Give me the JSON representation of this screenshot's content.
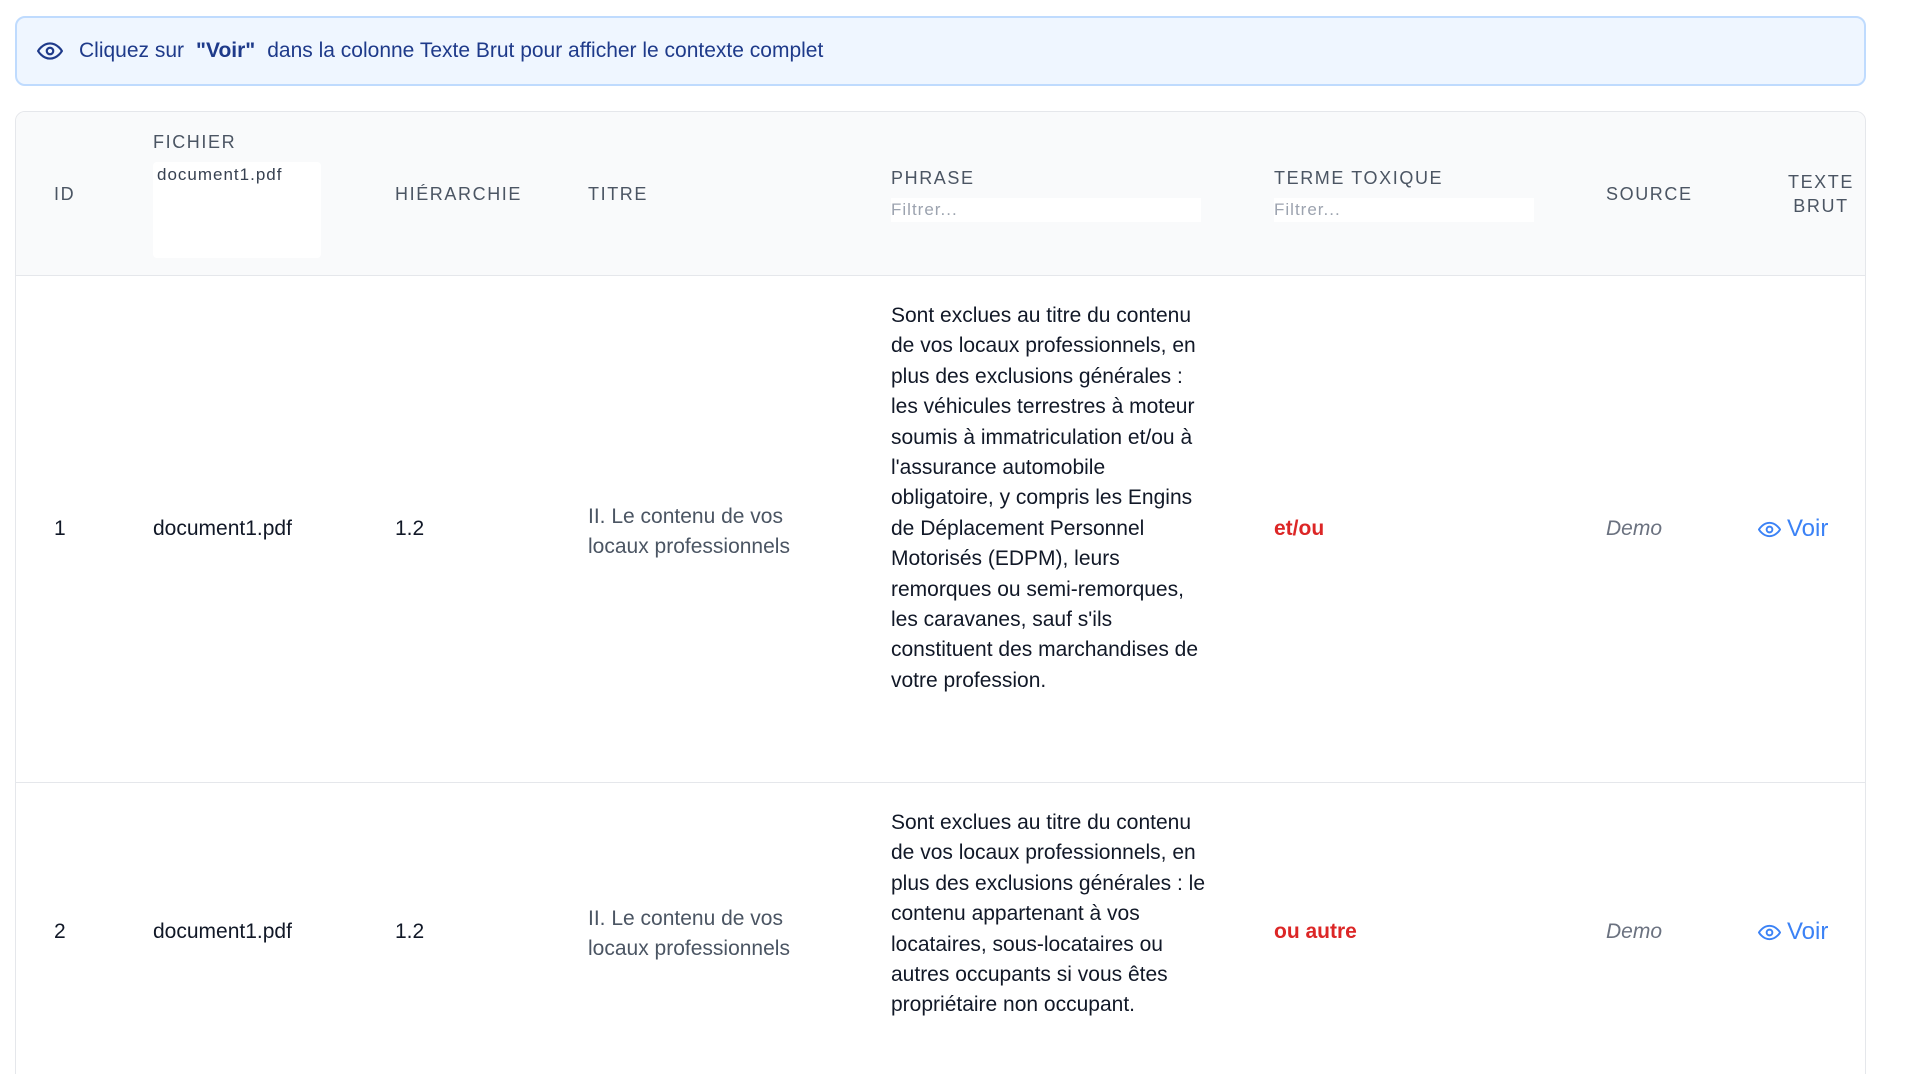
{
  "banner": {
    "prefix": "Cliquez sur",
    "strong": "\"Voir\"",
    "suffix": "dans la colonne Texte Brut pour afficher le contexte complet"
  },
  "columns": {
    "id": "ID",
    "fichier": "Fichier",
    "hierarchie": "Hiérarchie",
    "titre": "Titre",
    "phrase": "Phrase",
    "terme": "Terme Toxique",
    "source": "Source",
    "texte_brut_1": "Texte",
    "texte_brut_2": "Brut"
  },
  "filters": {
    "fichier_selected": "document1.pdf",
    "phrase_placeholder": "Filtrer...",
    "terme_placeholder": "Filtrer..."
  },
  "rows": [
    {
      "id": "1",
      "fichier": "document1.pdf",
      "hierarchie": "1.2",
      "titre": "II. Le contenu de vos locaux professionnels",
      "phrase": "Sont exclues au titre du contenu de vos locaux professionnels, en plus des exclusions générales : les véhicules terrestres à moteur soumis à immatriculation et/ou à l'assurance automobile obligatoire, y compris les Engins de Déplacement Personnel Motorisés (EDPM), leurs remorques ou semi-remorques, les caravanes, sauf s'ils constituent des marchandises de votre profession.",
      "terme": "et/ou",
      "source": "Demo",
      "action": "Voir"
    },
    {
      "id": "2",
      "fichier": "document1.pdf",
      "hierarchie": "1.2",
      "titre": "II. Le contenu de vos locaux professionnels",
      "phrase": "Sont exclues au titre du contenu de vos locaux professionnels, en plus des exclusions générales : le contenu appartenant à vos locataires, sous-locataires ou autres occupants si vous êtes propriétaire non occupant.",
      "terme": "ou autre",
      "source": "Demo",
      "action": "Voir"
    }
  ],
  "colors": {
    "accent": "#3b82f6",
    "toxic": "#dc2626",
    "banner_bg": "#eff6ff",
    "banner_border": "#bfdbfe"
  }
}
